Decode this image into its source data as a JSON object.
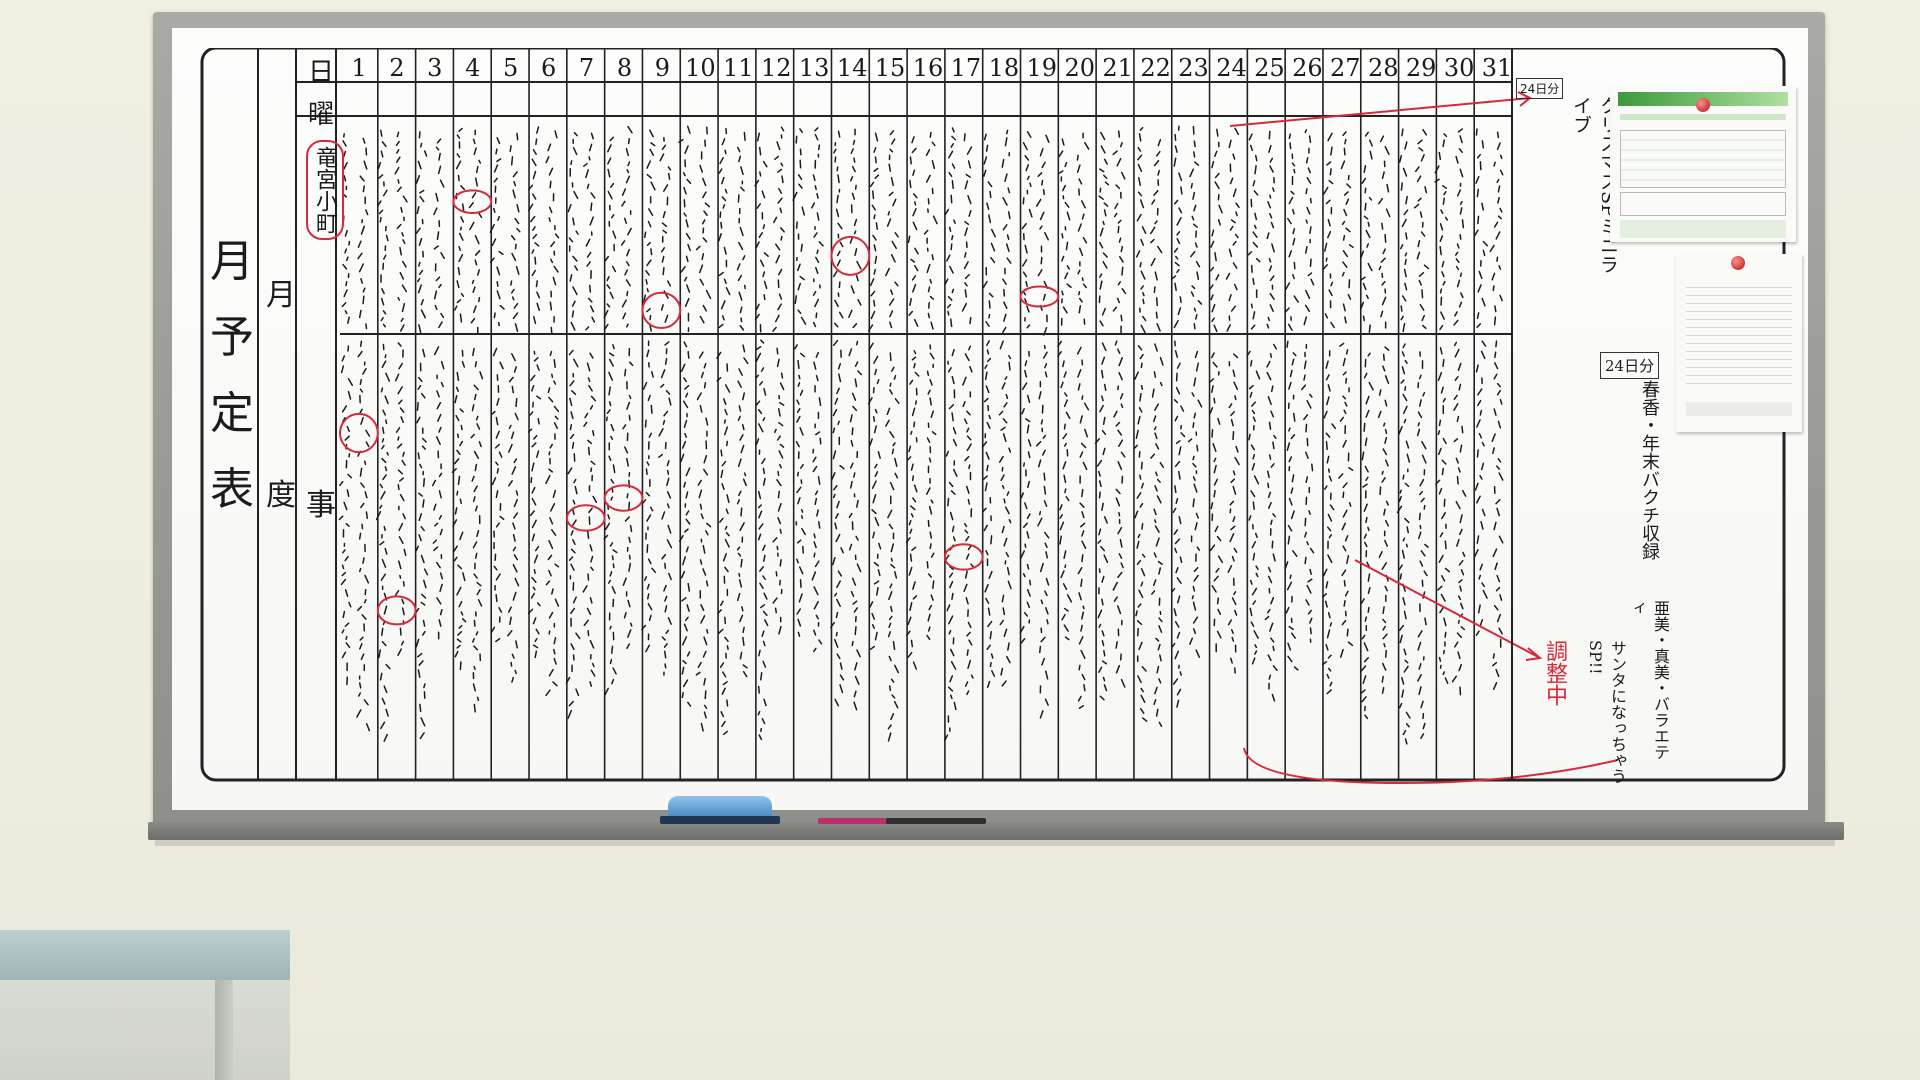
{
  "board": {
    "title_chars": [
      "月",
      "予",
      "定",
      "表"
    ],
    "subtitle_chars": [
      "月",
      "度"
    ],
    "row_labels": {
      "day": "日",
      "weekday": "曜",
      "events": "事"
    },
    "days": [
      "1",
      "2",
      "3",
      "4",
      "5",
      "6",
      "7",
      "8",
      "9",
      "10",
      "11",
      "12",
      "13",
      "14",
      "15",
      "16",
      "17",
      "18",
      "19",
      "20",
      "21",
      "22",
      "23",
      "24",
      "25",
      "26",
      "27",
      "28",
      "29",
      "30",
      "31"
    ],
    "extra_column_label": "24日分",
    "notes": {
      "left_circle": "竜宮小町",
      "right_top": "クリスマスSPミニライブ",
      "right_mid_1": "24日分",
      "right_mid_2": "春香・年末バクチ収録",
      "right_mid_3": "亜美・真美・バラエティ",
      "right_red": "調整中",
      "right_bottom": "サンタになっちゃう SP!!"
    },
    "posted_sheets": 2,
    "marker_color": "#d8283b",
    "ink_color": "#1b1b1b"
  }
}
